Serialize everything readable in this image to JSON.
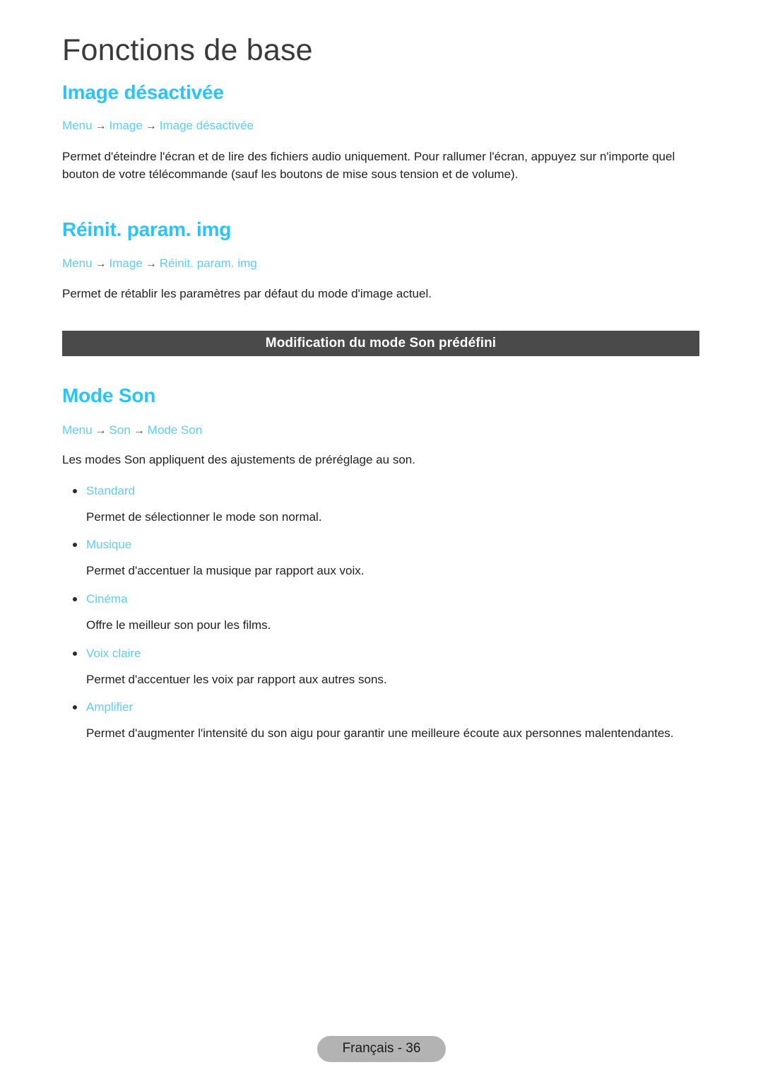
{
  "document": {
    "chapter_title": "Fonctions de base",
    "footer_label": "Français - 36",
    "accent_color": "#29c5f6",
    "breadcrumb_color": "#5ccdf7",
    "banner_bg_color": "#4a4a4a",
    "footer_pill_color": "#b3b3b3"
  },
  "sections": {
    "image_off": {
      "heading": "Image désactivée",
      "breadcrumb": {
        "item1": "Menu",
        "arrow1": "→",
        "item2": "Image",
        "arrow2": "→",
        "item3": "Image désactivée"
      },
      "body": "Permet d'éteindre l'écran et de lire des fichiers audio uniquement. Pour rallumer l'écran, appuyez sur n'importe quel bouton de votre télécommande (sauf les boutons de mise sous tension et de volume)."
    },
    "reset_picture": {
      "heading": "Réinit. param. img",
      "breadcrumb": {
        "item1": "Menu",
        "arrow1": "→",
        "item2": "Image",
        "arrow2": "→",
        "item3": "Réinit. param. img"
      },
      "body": "Permet de rétablir les paramètres par défaut du mode d'image actuel."
    },
    "banner": {
      "label": "Modification du mode Son prédéfini"
    },
    "sound_mode": {
      "heading": "Mode Son",
      "breadcrumb": {
        "item1": "Menu",
        "arrow1": "→",
        "item2": "Son",
        "arrow2": "→",
        "item3": "Mode Son"
      },
      "body": "Les modes Son appliquent des ajustements de préréglage au son.",
      "modes": [
        {
          "label": "Standard",
          "description": "Permet de sélectionner le mode son normal."
        },
        {
          "label": "Musique",
          "description": "Permet d'accentuer la musique par rapport aux voix."
        },
        {
          "label": "Cinéma",
          "description": "Offre le meilleur son pour les films."
        },
        {
          "label": "Voix claire",
          "description": "Permet d'accentuer les voix par rapport aux autres sons."
        },
        {
          "label": "Amplifier",
          "description": "Permet d'augmenter l'intensité du son aigu pour garantir une meilleure écoute aux personnes malentendantes."
        }
      ]
    }
  }
}
